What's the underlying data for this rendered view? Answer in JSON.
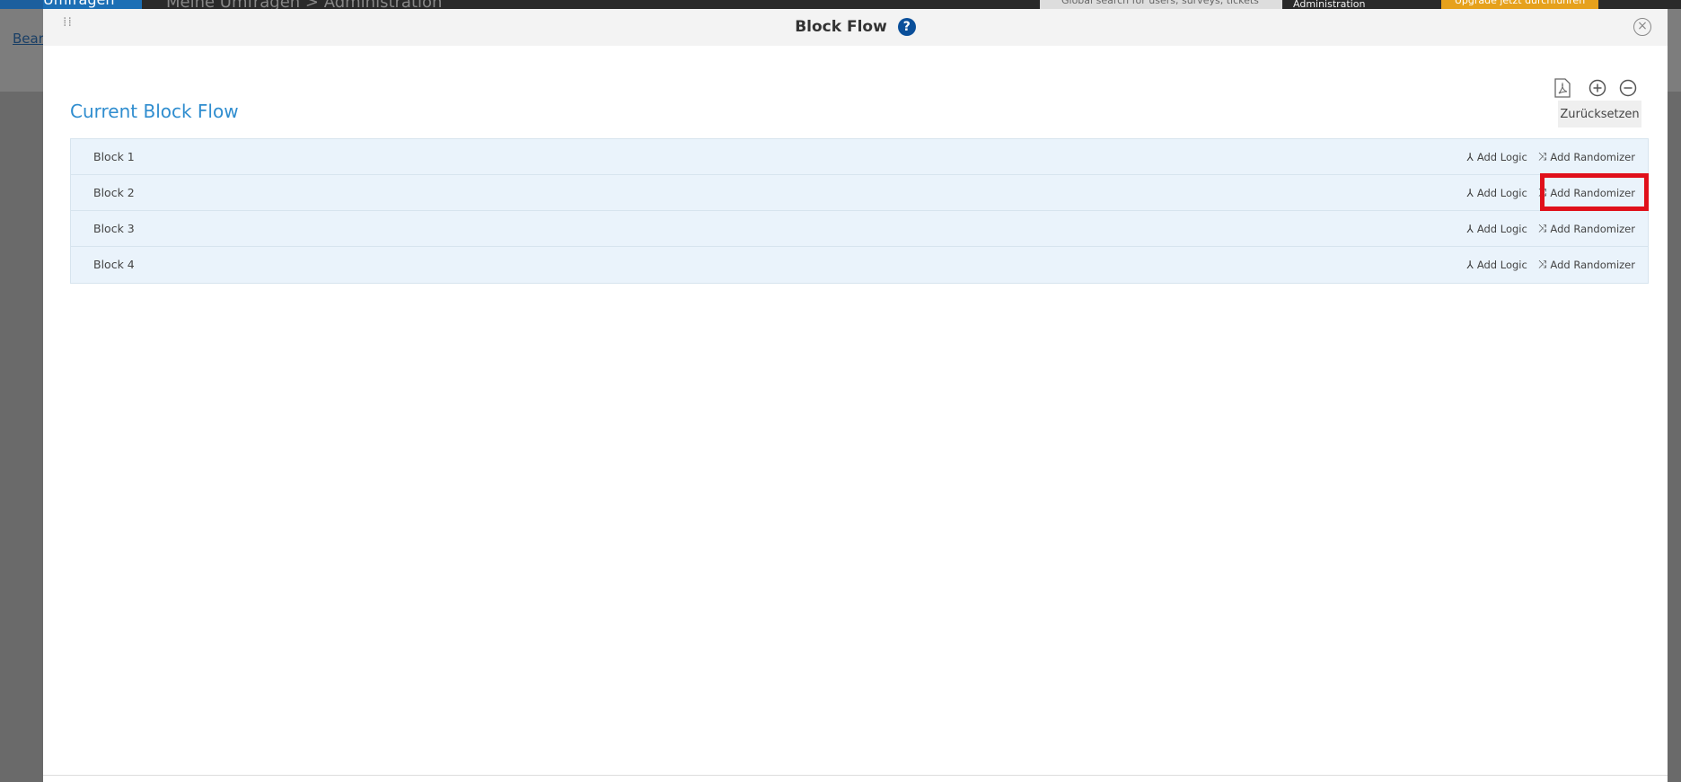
{
  "background": {
    "nav_item": "Umfragen",
    "breadcrumb": "Meine Umfragen > Administration",
    "search_placeholder": "Global search for users, surveys, tickets",
    "role_select": "Administration",
    "upgrade_button": "Upgrade jetzt durchführen",
    "tab": "Bearb"
  },
  "modal": {
    "title": "Block Flow",
    "help_icon": "question-circle-icon",
    "close_icon": "close-circle-icon",
    "heading": "Current Block Flow",
    "reset_button": "Zurücksetzen",
    "tools": [
      "pdf-icon",
      "zoom-in-icon",
      "zoom-out-icon"
    ],
    "blocks": [
      {
        "name": "Block 1",
        "logic": "Add Logic",
        "randomizer": "Add Randomizer"
      },
      {
        "name": "Block 2",
        "logic": "Add Logic",
        "randomizer": "Add Randomizer",
        "highlighted": true
      },
      {
        "name": "Block 3",
        "logic": "Add Logic",
        "randomizer": "Add Randomizer"
      },
      {
        "name": "Block 4",
        "logic": "Add Logic",
        "randomizer": "Add Randomizer"
      }
    ]
  },
  "colors": {
    "heading": "#2f8dcf",
    "row_bg": "#eaf3fb",
    "highlight": "#e0101a",
    "help": "#0a4f9a"
  }
}
